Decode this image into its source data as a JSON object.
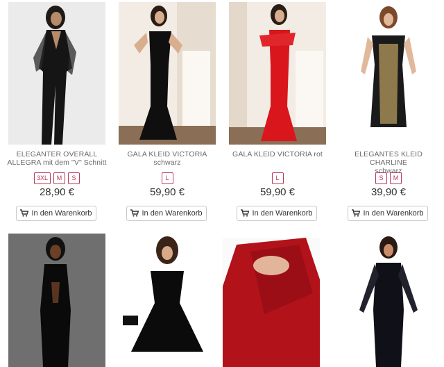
{
  "products": [
    {
      "title_line1": "ELEGANTER OVERALL",
      "title_line2": "ALLEGRA mit dem \"V\" Schnitt",
      "sizes": [
        "3XL",
        "M",
        "S"
      ],
      "price": "28,90 €",
      "cart_label": "In den Warenkorb",
      "image_desc": "black-jumpsuit-photo"
    },
    {
      "title_line1": "GALA KLEID VICTORIA",
      "title_line2": "schwarz",
      "sizes": [
        "L"
      ],
      "price": "59,90 €",
      "cart_label": "In den Warenkorb",
      "image_desc": "black-gown-photo"
    },
    {
      "title_line1": "GALA KLEID VICTORIA rot",
      "title_line2": "",
      "sizes": [
        "L"
      ],
      "price": "59,90 €",
      "cart_label": "In den Warenkorb",
      "image_desc": "red-gown-photo"
    },
    {
      "title_line1": "ELEGANTES KLEID CHARLINE",
      "title_line2": "schwarz",
      "sizes": [
        "S",
        "M"
      ],
      "price": "39,90 €",
      "cart_label": "In den Warenkorb",
      "image_desc": "lace-dress-photo"
    }
  ],
  "row2": [
    {
      "image_desc": "black-halter-dress-photo"
    },
    {
      "image_desc": "black-skater-dress-photo"
    },
    {
      "image_desc": "red-lace-dress-photo"
    },
    {
      "image_desc": "black-lace-longsleeve-dress-photo"
    }
  ],
  "colors": {
    "accent": "#b53b5c",
    "text": "#333333",
    "title": "#6a6a6a",
    "border": "#c9c9c9"
  }
}
